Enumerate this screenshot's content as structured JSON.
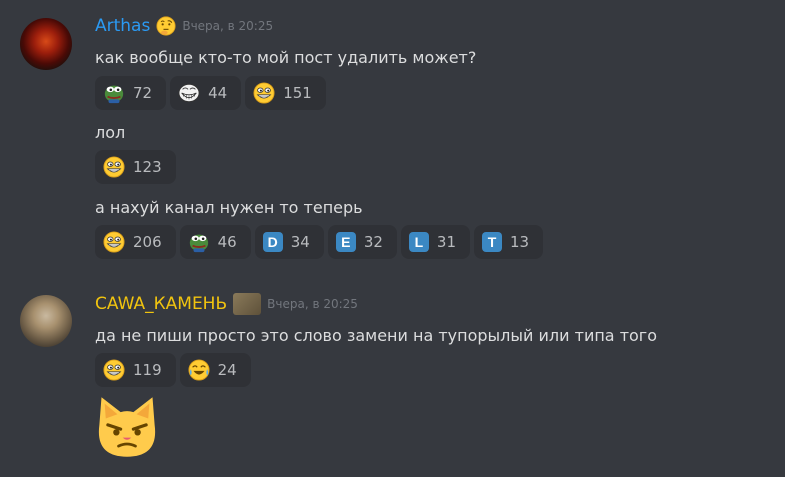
{
  "messages": [
    {
      "username": "Arthas",
      "username_color": "#2b9af3",
      "timestamp": "Вчера, в 20:25",
      "lines": [
        {
          "text": "как вообще кто-то мой пост удалить может?",
          "reactions": [
            {
              "icon": "pepe-icon",
              "count": "72"
            },
            {
              "icon": "trollface-icon",
              "count": "44"
            },
            {
              "icon": "grinning-face-icon",
              "count": "151"
            }
          ]
        },
        {
          "text": "лол",
          "reactions": [
            {
              "icon": "grinning-face-icon",
              "count": "123"
            }
          ]
        },
        {
          "text": "а нахуй канал нужен то теперь",
          "reactions": [
            {
              "icon": "grinning-face-icon",
              "count": "206"
            },
            {
              "icon": "pepe-icon",
              "count": "46"
            },
            {
              "letter": "D",
              "icon": "regional-indicator-d-icon",
              "count": "34"
            },
            {
              "letter": "E",
              "icon": "regional-indicator-e-icon",
              "count": "32"
            },
            {
              "letter": "L",
              "icon": "regional-indicator-l-icon",
              "count": "31"
            },
            {
              "letter": "T",
              "icon": "regional-indicator-t-icon",
              "count": "13"
            }
          ]
        }
      ]
    },
    {
      "username": "CAWA_КАМЕНЬ",
      "username_color": "#f1c40f",
      "timestamp": "Вчера, в 20:25",
      "lines": [
        {
          "text": "да не пиши просто это слово замени на тупорылый или типа того",
          "reactions": [
            {
              "icon": "grinning-face-icon",
              "count": "119"
            },
            {
              "icon": "joy-face-icon",
              "count": "24"
            }
          ]
        }
      ],
      "sticker": "smirk-cat-icon"
    }
  ]
}
